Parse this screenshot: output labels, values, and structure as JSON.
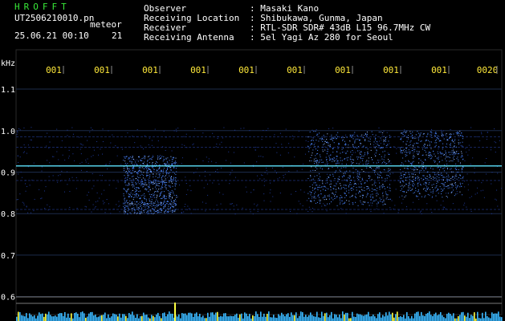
{
  "header": {
    "brand": "HROFFT",
    "file_name": "UT2506210010.pn",
    "file_tag": "meteor",
    "timestamp": "25.06.21 00:10",
    "count": "21",
    "meta": [
      {
        "label": "Observer",
        "value": ": Masaki Kano"
      },
      {
        "label": "Receiving Location",
        "value": ": Shibukawa, Gunma, Japan"
      },
      {
        "label": "Receiver",
        "value": ": RTL-SDR SDR# 43dB L15 96.7MHz CW"
      },
      {
        "label": "Receiving Antenna",
        "value": ": 5el Yagi Az 280 for Seoul"
      }
    ]
  },
  "chart_data": {
    "type": "heatmap",
    "ylabel": "kHz",
    "y_ticks": [
      "1.1",
      "1.0",
      "0.9",
      "0.8",
      "0.7",
      "0.6"
    ],
    "y_range": [
      0.58,
      1.16
    ],
    "time_labels": [
      "001",
      "001",
      "001",
      "001",
      "001",
      "001",
      "001",
      "001",
      "001",
      "0020"
    ],
    "grid": true,
    "colors": {
      "background": "#000000",
      "grid": "#1c2b4a",
      "signal": "#4b86ff",
      "carrier": "#5fe6ff",
      "time_label": "#ffe93a",
      "axis_text": "#ffffff",
      "level_bars": "#3ab8ff",
      "level_peaks": "#ffff40"
    },
    "echo_bursts": [
      {
        "t_start": 0.22,
        "t_end": 0.33,
        "f_low": 0.8,
        "f_high": 0.94,
        "intensity": 0.9
      },
      {
        "t_start": 0.6,
        "t_end": 0.77,
        "f_low": 0.82,
        "f_high": 1.0,
        "intensity": 0.8
      },
      {
        "t_start": 0.79,
        "t_end": 0.92,
        "f_low": 0.84,
        "f_high": 1.0,
        "intensity": 0.7
      }
    ],
    "carrier_khz": 0.915
  }
}
